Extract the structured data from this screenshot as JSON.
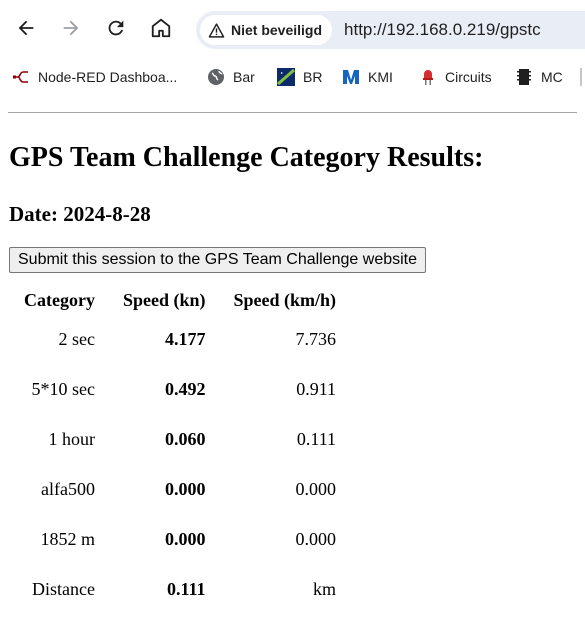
{
  "browser": {
    "security_label": "Niet beveiligd",
    "url": "http://192.168.0.219/gpstc",
    "bookmarks": [
      {
        "label": "Node-RED Dashboa...",
        "icon": "node-red-icon"
      },
      {
        "label": "Bar",
        "icon": "globe-icon"
      },
      {
        "label": "BR",
        "icon": "br-icon"
      },
      {
        "label": "KMI",
        "icon": "kmi-icon"
      },
      {
        "label": "Circuits",
        "icon": "led-icon"
      },
      {
        "label": "MC",
        "icon": "chip-icon"
      }
    ]
  },
  "page": {
    "title": "GPS Team Challenge Category Results:",
    "date": "Date: 2024-8-28",
    "submit_label": "Submit this session to the GPS Team Challenge website"
  },
  "table": {
    "headers": [
      "Category",
      "Speed (kn)",
      "Speed (km/h)"
    ],
    "rows": [
      {
        "category": "2 sec",
        "kn": "4.177",
        "kmh": "7.736"
      },
      {
        "category": "5*10 sec",
        "kn": "0.492",
        "kmh": "0.911"
      },
      {
        "category": "1 hour",
        "kn": "0.060",
        "kmh": "0.111"
      },
      {
        "category": "alfa500",
        "kn": "0.000",
        "kmh": "0.000"
      },
      {
        "category": "1852 m",
        "kn": "0.000",
        "kmh": "0.000"
      },
      {
        "category": "Distance",
        "kn": "0.111",
        "kmh": "km"
      }
    ]
  },
  "colors": {
    "omnibox_bg": "#e9eef6",
    "kmi_blue": "#1565c0",
    "node_red": "#8f0000",
    "led_red": "#d32f2f"
  }
}
